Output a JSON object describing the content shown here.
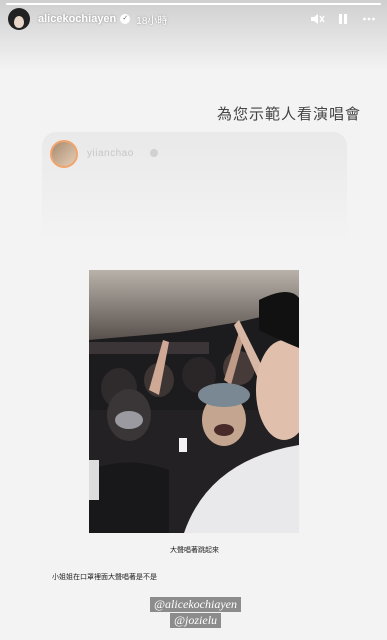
{
  "story": {
    "progress": 1.0,
    "username": "alicekochiayen",
    "time_ago": "18小時",
    "icons": {
      "verified": "verified-badge-icon",
      "mute": "speaker-muted-icon",
      "pause": "pause-icon",
      "more": "more-icon"
    }
  },
  "caption": {
    "title": "為您示範人看演唱會"
  },
  "shared_post": {
    "username": "yiianchao"
  },
  "photo": {
    "caption": "大聲唱著跳起來",
    "note": "小姐姐在口罩裡面大聲唱著是不是"
  },
  "mentions": [
    "@alicekochiayen",
    "@jozielu"
  ]
}
